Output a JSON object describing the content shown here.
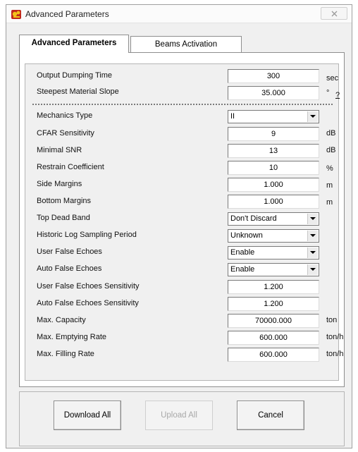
{
  "window": {
    "title": "Advanced Parameters",
    "icon": "app-logo-icon"
  },
  "tabs": [
    {
      "label": "Advanced Parameters",
      "active": true
    },
    {
      "label": "Beams Activation",
      "active": false
    }
  ],
  "fields": {
    "output_dumping_time": {
      "label": "Output Dumping Time",
      "value": "300",
      "unit": "sec"
    },
    "steepest_material_slope": {
      "label": "Steepest Material Slope",
      "value": "35.000",
      "unit": "°",
      "help": "?"
    },
    "mechanics_type": {
      "label": "Mechanics Type",
      "value": "II"
    },
    "cfar_sensitivity": {
      "label": "CFAR Sensitivity",
      "value": "9",
      "unit": "dB"
    },
    "minimal_snr": {
      "label": "Minimal SNR",
      "value": "13",
      "unit": "dB"
    },
    "restrain_coefficient": {
      "label": "Restrain Coefficient",
      "value": "10",
      "unit": "%"
    },
    "side_margins": {
      "label": "Side Margins",
      "value": "1.000",
      "unit": "m"
    },
    "bottom_margins": {
      "label": "Bottom Margins",
      "value": "1.000",
      "unit": "m"
    },
    "top_dead_band": {
      "label": "Top Dead Band",
      "value": "Don't Discard"
    },
    "historic_log_sampling_period": {
      "label": "Historic Log Sampling Period",
      "value": "Unknown"
    },
    "user_false_echoes": {
      "label": "User False Echoes",
      "value": "Enable"
    },
    "auto_false_echoes": {
      "label": "Auto False Echoes",
      "value": "Enable"
    },
    "user_false_echoes_sensitivity": {
      "label": "User False Echoes Sensitivity",
      "value": "1.200"
    },
    "auto_false_echoes_sensitivity": {
      "label": "Auto False Echoes Sensitivity",
      "value": "1.200"
    },
    "max_capacity": {
      "label": "Max. Capacity",
      "value": "70000.000",
      "unit": "ton"
    },
    "max_emptying_rate": {
      "label": "Max. Emptying Rate",
      "value": "600.000",
      "unit": "ton/h"
    },
    "max_filling_rate": {
      "label": "Max. Filling Rate",
      "value": "600.000",
      "unit": "ton/h"
    }
  },
  "buttons": {
    "download_all": "Download All",
    "upload_all": "Upload All",
    "cancel": "Cancel"
  },
  "colors": {
    "icon_red": "#c0281c",
    "icon_yellow": "#f2c21a"
  }
}
